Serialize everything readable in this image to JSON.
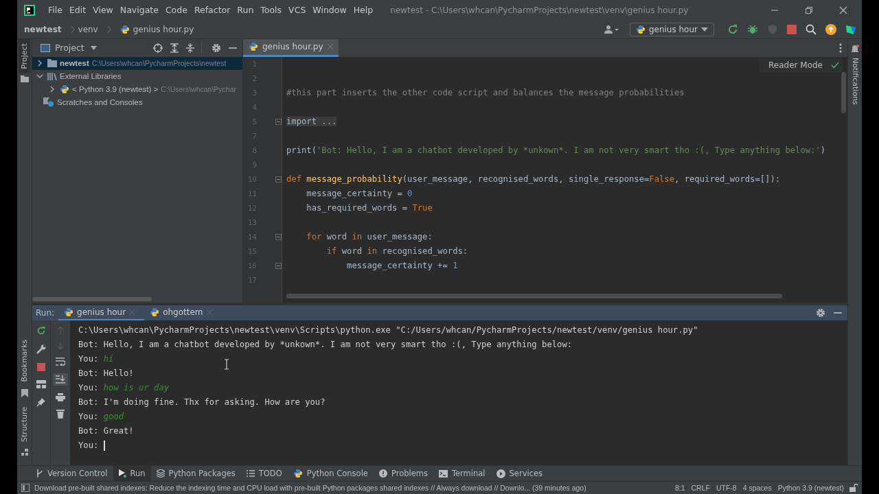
{
  "window": {
    "title": "newtest - C:\\Users\\whcan\\PycharmProjects\\newtest\\venv\\genius hour.py"
  },
  "menu": [
    "File",
    "Edit",
    "View",
    "Navigate",
    "Code",
    "Refactor",
    "Run",
    "Tools",
    "VCS",
    "Window",
    "Help"
  ],
  "breadcrumbs": [
    "newtest",
    "venv",
    "genius hour.py"
  ],
  "run_config": "genius hour",
  "left_stripe": [
    {
      "label": "Project",
      "selected": true
    },
    {
      "label": "Bookmarks",
      "selected": false
    },
    {
      "label": "Structure",
      "selected": false
    }
  ],
  "right_stripe": [
    "Notifications"
  ],
  "project": {
    "title": "Project",
    "tree": [
      {
        "kind": "folder",
        "label": "newtest",
        "path": "C:\\Users\\whcan\\PycharmProjects\\newtest",
        "expanded": false,
        "selected": true
      },
      {
        "kind": "library",
        "label": "External Libraries",
        "expanded": true,
        "selected": false,
        "children": [
          {
            "kind": "python",
            "label": "< Python 3.9 (newtest) >",
            "path": "C:\\Users\\whcan\\Pychar",
            "expanded": false,
            "selected": false
          }
        ]
      },
      {
        "kind": "scratches",
        "label": "Scratches and Consoles",
        "selected": false
      }
    ]
  },
  "editor": {
    "tabs": [
      {
        "label": "genius hour.py",
        "selected": true
      }
    ],
    "reader_mode": "Reader Mode",
    "lines": [
      {
        "number": "1",
        "fold": false
      },
      {
        "number": "2",
        "fold": false
      },
      {
        "number": "3",
        "fold": false,
        "tokens": [
          {
            "kind": "comment",
            "text": "#this part inserts the other code script and balances the message probabilities"
          }
        ]
      },
      {
        "number": "4",
        "fold": false
      },
      {
        "number": "5",
        "fold": true,
        "tokens": [
          {
            "kind": "folded",
            "text": "import ..."
          }
        ]
      },
      {
        "number": "7",
        "fold": false
      },
      {
        "number": "8",
        "fold": false,
        "tokens": [
          {
            "kind": "plain",
            "text": "print("
          },
          {
            "kind": "string",
            "text": "'Bot: Hello, I am a chatbot developed by *unkown*. I am not very smart tho :(, Type anything below:'"
          },
          {
            "kind": "plain",
            "text": ")"
          }
        ]
      },
      {
        "number": "9",
        "fold": false
      },
      {
        "number": "10",
        "fold": true,
        "tokens": [
          {
            "kind": "keyword",
            "text": "def "
          },
          {
            "kind": "function",
            "text": "message_probability"
          },
          {
            "kind": "plain",
            "text": "(user_message, recognised_words, single_response="
          },
          {
            "kind": "keyword",
            "text": "False"
          },
          {
            "kind": "plain",
            "text": ", required_words=[]):"
          }
        ]
      },
      {
        "number": "11",
        "fold": false,
        "tokens": [
          {
            "kind": "plain",
            "text": "    message_certainty = "
          },
          {
            "kind": "number",
            "text": "0"
          }
        ]
      },
      {
        "number": "12",
        "fold": false,
        "tokens": [
          {
            "kind": "plain",
            "text": "    has_required_words = "
          },
          {
            "kind": "keyword",
            "text": "True"
          }
        ]
      },
      {
        "number": "13",
        "fold": false
      },
      {
        "number": "14",
        "fold": true,
        "tokens": [
          {
            "kind": "keyword",
            "text": "    for "
          },
          {
            "kind": "plain",
            "text": "word "
          },
          {
            "kind": "keyword",
            "text": "in "
          },
          {
            "kind": "plain",
            "text": "user_message:"
          }
        ]
      },
      {
        "number": "15",
        "fold": false,
        "tokens": [
          {
            "kind": "keyword",
            "text": "        if "
          },
          {
            "kind": "plain",
            "text": "word "
          },
          {
            "kind": "keyword",
            "text": "in "
          },
          {
            "kind": "plain",
            "text": "recognised_words:"
          }
        ]
      },
      {
        "number": "16",
        "fold": true,
        "tokens": [
          {
            "kind": "plain",
            "text": "            message_certainty += "
          },
          {
            "kind": "number",
            "text": "1"
          }
        ]
      },
      {
        "number": "17",
        "fold": false
      }
    ]
  },
  "run": {
    "label": "Run:",
    "tabs": [
      {
        "label": "genius hour",
        "selected": true
      },
      {
        "label": "ohgottem",
        "selected": false
      }
    ],
    "console": [
      {
        "kind": "output",
        "text": "C:\\Users\\whcan\\PycharmProjects\\newtest\\venv\\Scripts\\python.exe \"C:/Users/whcan/PycharmProjects/newtest/venv/genius hour.py\""
      },
      {
        "kind": "output",
        "text": "Bot: Hello, I am a chatbot developed by *unkown*. I am not very smart tho :(, Type anything below:"
      },
      {
        "kind": "input",
        "prefix": "You:",
        "text": "hi"
      },
      {
        "kind": "output",
        "text": "Bot: Hello!"
      },
      {
        "kind": "input",
        "prefix": "You:",
        "text": "how is ur day"
      },
      {
        "kind": "output",
        "text": "Bot: I'm doing fine. Thx for asking. How are you?"
      },
      {
        "kind": "input",
        "prefix": "You:",
        "text": "good"
      },
      {
        "kind": "output",
        "text": "Bot: Great!"
      },
      {
        "kind": "prompt",
        "prefix": "You:"
      }
    ]
  },
  "bottom_tools": [
    {
      "kind": "vcs",
      "label": "Version Control",
      "selected": false
    },
    {
      "kind": "run",
      "label": "Run",
      "selected": true
    },
    {
      "kind": "packages",
      "label": "Python Packages",
      "selected": false
    },
    {
      "kind": "todo",
      "label": "TODO",
      "selected": false
    },
    {
      "kind": "console",
      "label": "Python Console",
      "selected": false
    },
    {
      "kind": "problems",
      "label": "Problems",
      "selected": false
    },
    {
      "kind": "terminal",
      "label": "Terminal",
      "selected": false
    },
    {
      "kind": "services",
      "label": "Services",
      "selected": false
    }
  ],
  "status_bar": {
    "message": "Download pre-built shared indexes: Reduce the indexing time and CPU load with pre-built Python packages shared indexes // Always download // Downlo... (39 minutes ago)",
    "items": [
      "8:1",
      "CRLF",
      "UTF-8",
      "4 spaces",
      "Python 3.9 (newtest)"
    ]
  }
}
